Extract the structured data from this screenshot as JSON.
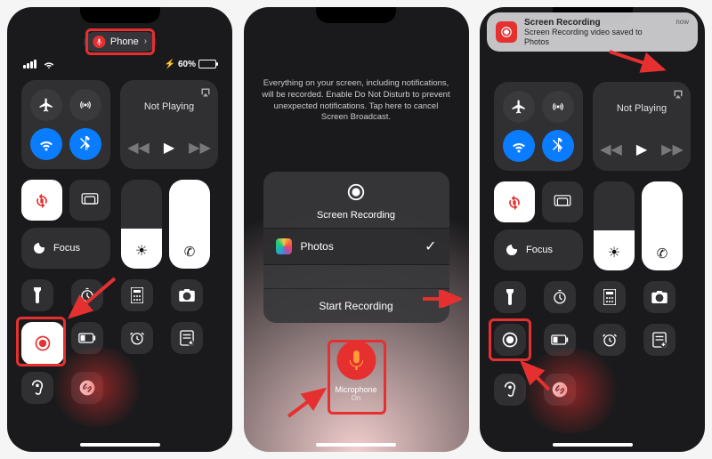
{
  "status": {
    "battery_pct": "60%",
    "wifi_label": "wifi"
  },
  "pill": {
    "label": "Phone",
    "icon": "microphone"
  },
  "media": {
    "title": "Not Playing"
  },
  "cc": {
    "focus_label": "Focus"
  },
  "tiles": {
    "airplane": "airplane-icon",
    "airdrop": "airdrop-icon",
    "wifi": "wifi-icon",
    "bluetooth": "bluetooth-icon",
    "rotation_lock": "rotation-lock-icon",
    "screen_mirror": "screen-mirror-icon",
    "moon": "moon-icon",
    "brightness": "brightness-slider",
    "mute": "phone-icon",
    "flashlight": "flashlight-icon",
    "timer": "timer-icon",
    "calculator": "calculator-icon",
    "camera": "camera-icon",
    "record": "record-icon",
    "low_power": "low-power-icon",
    "alarm": "alarm-icon",
    "add_note": "add-note-icon",
    "hearing": "hearing-icon",
    "shazam": "shazam-icon"
  },
  "modal": {
    "disclaimer": "Everything on your screen, including notifications, will be recorded. Enable Do Not Disturb to prevent unexpected notifications. Tap here to cancel Screen Broadcast.",
    "title": "Screen Recording",
    "option": "Photos",
    "start": "Start Recording",
    "mic_label": "Microphone",
    "mic_state": "On"
  },
  "notif": {
    "title": "Screen Recording",
    "body": "Screen Recording video saved to Photos",
    "time": "now"
  }
}
